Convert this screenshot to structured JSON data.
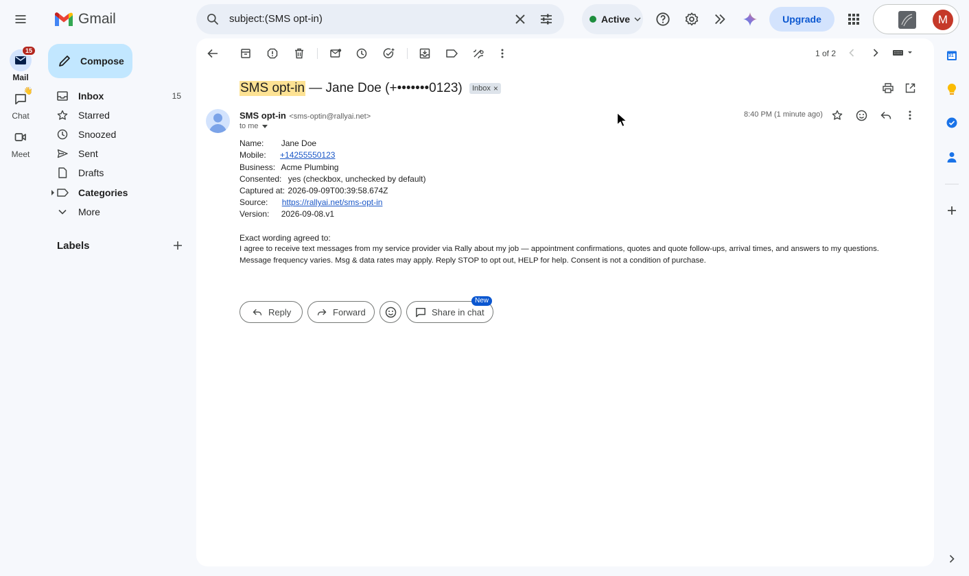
{
  "app": {
    "name": "Gmail"
  },
  "rail": {
    "mail_label": "Mail",
    "mail_badge": "15",
    "chat_label": "Chat",
    "meet_label": "Meet"
  },
  "compose_label": "Compose",
  "nav": [
    {
      "label": "Inbox",
      "count": "15"
    },
    {
      "label": "Starred",
      "count": ""
    },
    {
      "label": "Snoozed",
      "count": ""
    },
    {
      "label": "Sent",
      "count": ""
    },
    {
      "label": "Drafts",
      "count": ""
    },
    {
      "label": "Categories",
      "count": ""
    },
    {
      "label": "More",
      "count": ""
    }
  ],
  "labels_heading": "Labels",
  "search": {
    "value": "subject:(SMS opt-in)"
  },
  "status": {
    "label": "Active",
    "color": "#1e8e3e"
  },
  "upgrade_label": "Upgrade",
  "avatar_initial": "M",
  "pager": "1 of 2",
  "email": {
    "subject_highlight": "SMS opt-in",
    "subject_rest": " — Jane Doe (+•••••••0123)",
    "label_chip": "Inbox",
    "sender_name": "SMS opt-in",
    "sender_email": "<sms-optin@rallyai.net>",
    "to": "to me",
    "time": "8:40 PM (1 minute ago)",
    "fields": {
      "name_label": "Name:",
      "name_value": "Jane Doe",
      "mobile_label": "Mobile:",
      "mobile_value": "+14255550123",
      "business_label": "Business:",
      "business_value": "Acme Plumbing",
      "consented_label": "Consented:",
      "consented_value": "yes (checkbox, unchecked by default)",
      "captured_label": "Captured at:",
      "captured_value": "2026-09-09T00:39:58.674Z",
      "source_label": "Source:",
      "source_value": "https://rallyai.net/sms-opt-in",
      "version_label": "Version:",
      "version_value": "2026-09-08.v1"
    },
    "wording_heading": "Exact wording agreed to:",
    "wording_line1": "I agree to receive text messages from my service provider via Rally about my job — appointment confirmations, quotes and quote follow-ups, arrival times, and answers to my questions.",
    "wording_line2": "Message frequency varies. Msg & data rates may apply. Reply STOP to opt out, HELP for help. Consent is not a condition of purchase."
  },
  "actions": {
    "reply": "Reply",
    "forward": "Forward",
    "share": "Share in chat",
    "new_badge": "New"
  },
  "right_panel": {
    "calendar_day": "31"
  },
  "colors": {
    "accent": "#0b57d0",
    "highlight": "#fde293",
    "badge": "#b3261e"
  }
}
